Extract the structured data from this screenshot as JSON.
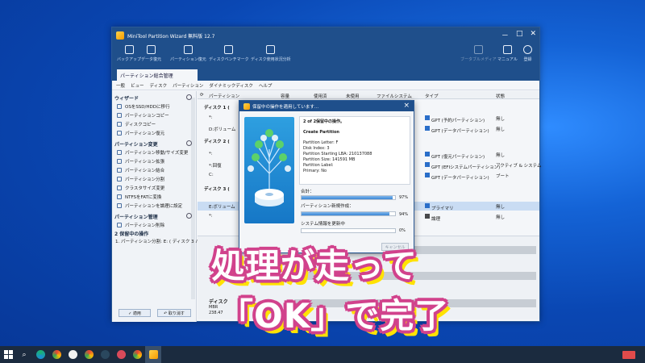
{
  "window": {
    "title": "MiniTool Partition Wizard 無料版 12.7",
    "controls": [
      "－",
      "□",
      "✕"
    ]
  },
  "toolbar": {
    "backup": "バックアップ",
    "data_recovery": "データ復元",
    "partition_recovery": "パーティション復元",
    "disk_benchmark": "ディスクベンチマーク",
    "space_analyzer": "ディスク使用状況分析",
    "bootable": "ブータブルメディア",
    "manual": "マニュアル",
    "register": "登録"
  },
  "tab": "パーティション総合管理",
  "menu": [
    "一般",
    "ビュー",
    "ディスク",
    "パーティション",
    "ダイナミックディスク",
    "ヘルプ"
  ],
  "sidebar": {
    "wizard_title": "ウィザード",
    "wizard_items": [
      "OSをSSD/HDDに移行",
      "パーティションコピー",
      "ディスクコピー",
      "パーティション復元"
    ],
    "change_title": "パーティション変更",
    "change_items": [
      "パーティション移動/サイズ変更",
      "パーティション拡張",
      "パーティション結合",
      "パーティション分割",
      "クラスタサイズ変更",
      "NTFSをFATに変換",
      "パーティションを論理に設定"
    ],
    "manage_title": "パーティション管理",
    "manage_items": [
      "パーティション削除"
    ],
    "pending_title": "2 保留中の操作",
    "pending_items": [
      "1. パーティション分割: E: ( ディスク 3 パ..."
    ],
    "apply": "✓ 適用",
    "undo": "↶ 取り消す"
  },
  "columns": [
    "パーティション",
    "容量",
    "使用済",
    "未使用",
    "ファイルシステム",
    "タイプ",
    "状態"
  ],
  "rows": [
    {
      "partition": "ディスク 1 (",
      "type": "",
      "status": "",
      "disk": true
    },
    {
      "partition": "*:",
      "type": "GPT (予約パーティション)",
      "status": "無し"
    },
    {
      "partition": "D:ボリューム",
      "type": "GPT (データパーティション)",
      "status": "無し"
    },
    {
      "partition": "ディスク 2 (",
      "type": "",
      "status": "",
      "disk": true
    },
    {
      "partition": "*:",
      "type": "GPT (復元パーティション)",
      "status": "無し"
    },
    {
      "partition": "*:回復",
      "type": "GPT (EFIシステムパーティション)",
      "status": "アクティブ & システム"
    },
    {
      "partition": "C:",
      "type": "GPT (データパーティション)",
      "status": "ブート"
    },
    {
      "partition": "ディスク 3 (",
      "type": "",
      "status": "",
      "disk": true
    },
    {
      "partition": "E:ボリューム",
      "type": "プライマリ",
      "status": "無し",
      "selected": true
    },
    {
      "partition": "*:",
      "type": "論理",
      "status": "無し"
    }
  ],
  "disk_map": {
    "label": "ディスク",
    "sub1": "MBR",
    "sub2": "238.47"
  },
  "dialog": {
    "title": "保留中の操作を適用しています...",
    "step": "2 of 2保留中の操作。",
    "operation": "Create Partition",
    "details": [
      "Partition Letter: F",
      "Disk Index: 3",
      "Partition Starting LBA: 210137088",
      "Partition Size: 141591 MB",
      "Partition Label:",
      "Primary: No"
    ],
    "progress": [
      {
        "label": "合計：",
        "percent": 97,
        "pct_text": "97%"
      },
      {
        "label": "パーティション新規作成：",
        "percent": 94,
        "pct_text": "94%"
      },
      {
        "label": "システム情報を更新中",
        "percent": 0,
        "pct_text": "0%"
      }
    ],
    "cancel": "キャンセル"
  },
  "caption": {
    "line1": "処理が走って",
    "line2": "「OK」で完了"
  },
  "taskbar_icons": [
    "windows-icon",
    "search-icon",
    "edge-icon",
    "chrome-icon",
    "app-icon",
    "chrome-icon",
    "steam-icon",
    "app-icon",
    "chrome-icon",
    "minitool-icon"
  ],
  "colors": {
    "titlebar": "#1f4f8b",
    "caption_outline": "#d1428c",
    "caption_shadow": "#ffe200",
    "progress": "#3a86d4"
  }
}
